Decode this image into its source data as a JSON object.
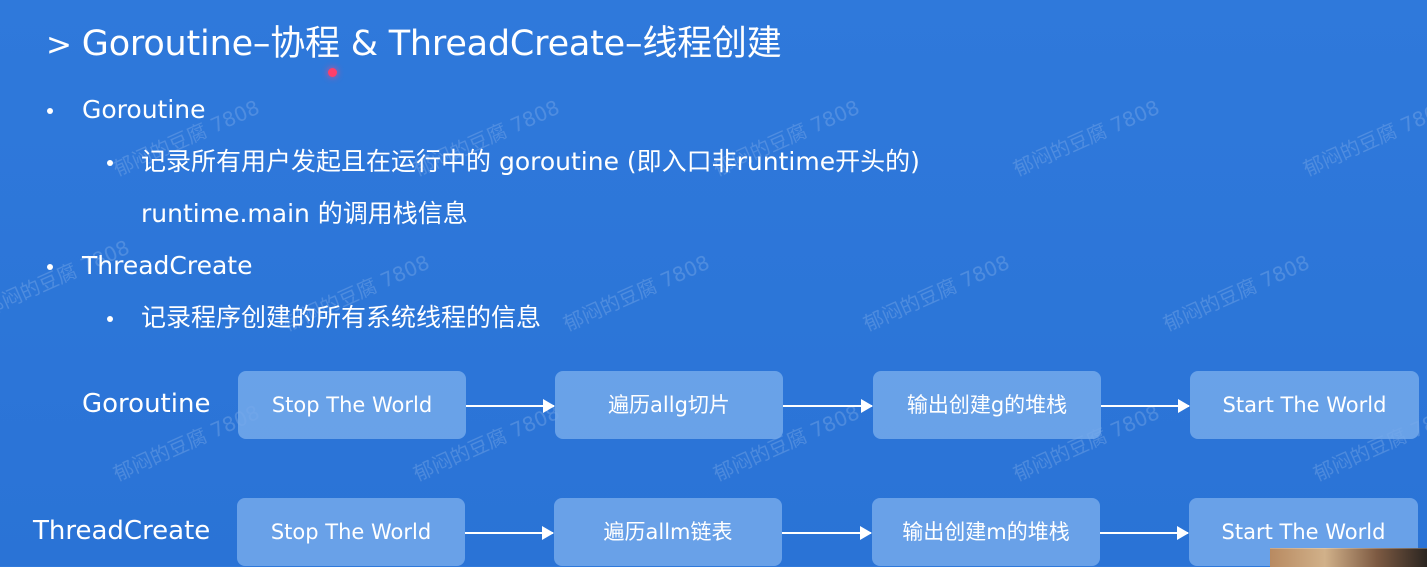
{
  "slide": {
    "title": "Goroutine–协程 & ThreadCreate–线程创建",
    "title_marker": ">",
    "bullets": [
      {
        "label": "Goroutine",
        "children": [
          {
            "line1": "记录所有用户发起且在运行中的 goroutine (即入口非runtime开头的)",
            "line2": "runtime.main 的调用栈信息"
          }
        ]
      },
      {
        "label": "ThreadCreate",
        "children": [
          {
            "line1": "记录程序创建的所有系统线程的信息"
          }
        ]
      }
    ],
    "flows": [
      {
        "label": "Goroutine",
        "steps": [
          "Stop The World",
          "遍历allg切片",
          "输出创建g的堆栈",
          "Start The World"
        ]
      },
      {
        "label": "ThreadCreate",
        "steps": [
          "Stop The World",
          "遍历allm链表",
          "输出创建m的堆栈",
          "Start The World"
        ]
      }
    ],
    "watermark": "郁闷的豆腐 7808",
    "colors": {
      "background": "#2f79db",
      "step_box": "#76abec",
      "text": "#ffffff",
      "laser": "#ff3f6a"
    }
  }
}
